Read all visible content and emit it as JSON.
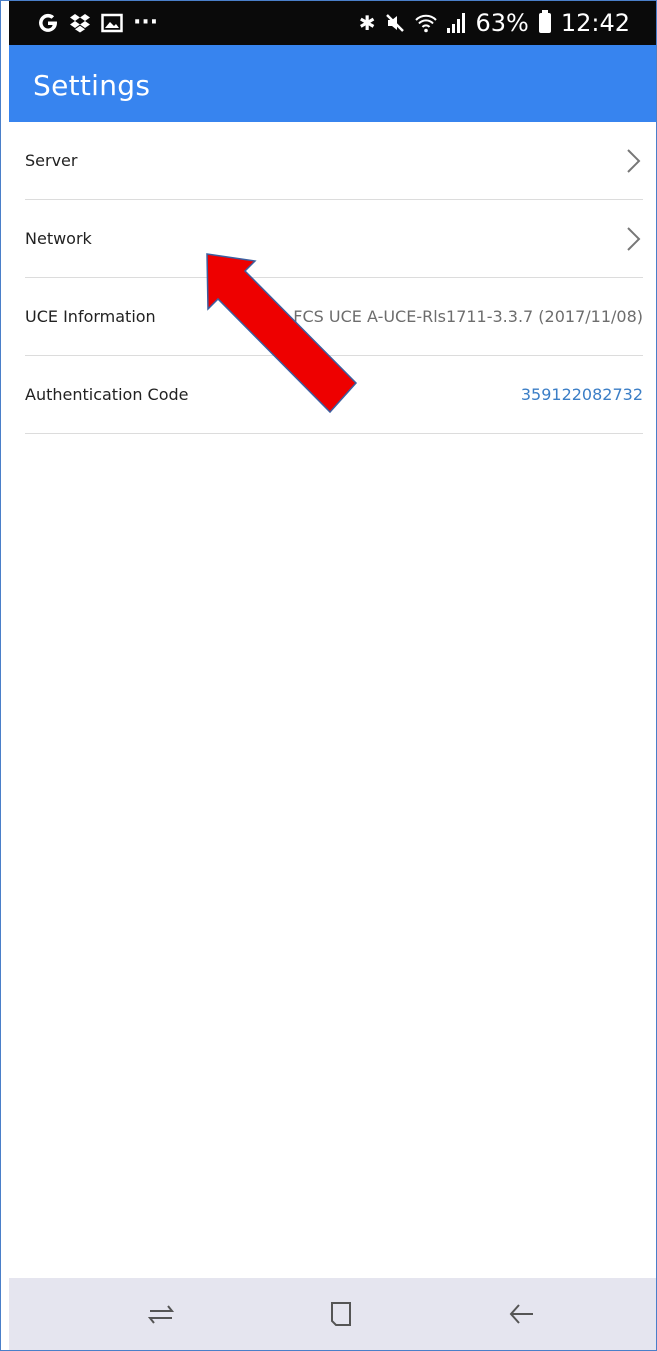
{
  "status_bar": {
    "left_icons": [
      "google-g-icon",
      "dropbox-icon",
      "gallery-icon",
      "more-dots-icon"
    ],
    "more_dots": "···",
    "battery_percent": "63%",
    "time": "12:42"
  },
  "app_bar": {
    "title": "Settings",
    "color": "#3784ef"
  },
  "settings": {
    "items": [
      {
        "label": "Server",
        "type": "nav"
      },
      {
        "label": "Network",
        "type": "nav"
      },
      {
        "label": "UCE Information",
        "value": "FCS UCE A-UCE-Rls1711-3.3.7 (2017/11/08)",
        "type": "info"
      },
      {
        "label": "Authentication Code",
        "value": "359122082732",
        "type": "info",
        "value_color": "#3b7ec6"
      }
    ]
  },
  "nav_bar": {
    "buttons": [
      "recent-apps-icon",
      "home-icon",
      "back-icon"
    ]
  },
  "annotation": {
    "arrow_color": "#ee0000",
    "arrow_outline": "#3b5fa0"
  }
}
